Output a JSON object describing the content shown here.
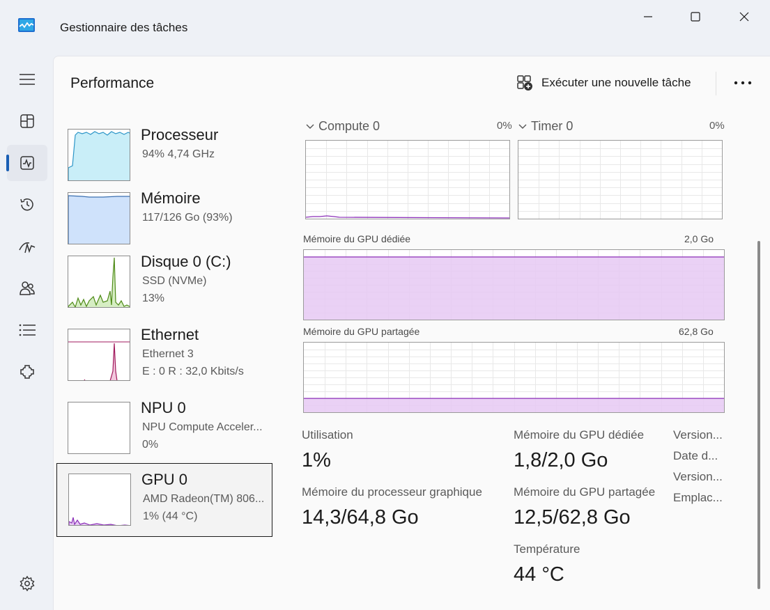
{
  "window": {
    "title": "Gestionnaire des tâches"
  },
  "header": {
    "title": "Performance",
    "run_task_label": "Exécuter une nouvelle tâche"
  },
  "nav": {
    "items": [
      "hamburger-icon",
      "processes-icon",
      "performance-icon",
      "app-history-icon",
      "startup-icon",
      "users-icon",
      "details-icon",
      "services-icon",
      "settings-icon"
    ],
    "active": "performance"
  },
  "devices": [
    {
      "name": "Processeur",
      "line1": "94%  4,74 GHz",
      "line2": "",
      "color": "#2b95c7",
      "fill": "#c9eef8"
    },
    {
      "name": "Mémoire",
      "line1": "117/126 Go (93%)",
      "line2": "",
      "color": "#3a6fb0",
      "fill": "#cfe2fb"
    },
    {
      "name": "Disque 0 (C:)",
      "line1": "SSD (NVMe)",
      "line2": "13%",
      "color": "#4e8a17",
      "fill": "#d6eec3"
    },
    {
      "name": "Ethernet",
      "line1": "Ethernet 3",
      "line2": "E : 0  R : 32,0 Kbits/s",
      "color": "#a0195c",
      "fill": "#f2c7dd"
    },
    {
      "name": "NPU 0",
      "line1": "NPU Compute Acceler...",
      "line2": "0%",
      "color": "#888888",
      "fill": "#ffffff"
    },
    {
      "name": "GPU 0",
      "line1": "AMD Radeon(TM) 806...",
      "line2": "1%  (44 °C)",
      "color": "#8b2fb8",
      "fill": "#e6c9f3"
    }
  ],
  "gpu": {
    "engines": [
      {
        "name": "Compute 0",
        "value": "0%"
      },
      {
        "name": "Timer 0",
        "value": "0%"
      }
    ],
    "dedicated_graph": {
      "label": "Mémoire du GPU dédiée",
      "max": "2,0 Go"
    },
    "shared_graph": {
      "label": "Mémoire du GPU partagée",
      "max": "62,8 Go"
    },
    "stats": {
      "utilisation_label": "Utilisation",
      "utilisation_value": "1%",
      "proc_mem_label": "Mémoire du processeur graphique",
      "proc_mem_value": "14,3/64,8 Go",
      "dedicated_label": "Mémoire du GPU dédiée",
      "dedicated_value": "1,8/2,0 Go",
      "shared_label": "Mémoire du GPU partagée",
      "shared_value": "12,5/62,8 Go",
      "temp_label": "Température",
      "temp_value": "44 °C"
    },
    "side_labels": [
      "Version...",
      "Date d...",
      "Version...",
      "Emplac..."
    ]
  },
  "colors": {
    "gpu_line": "#8b2fb8",
    "gpu_fill": "#e6c9f3",
    "accent": "#1a5fb4"
  }
}
